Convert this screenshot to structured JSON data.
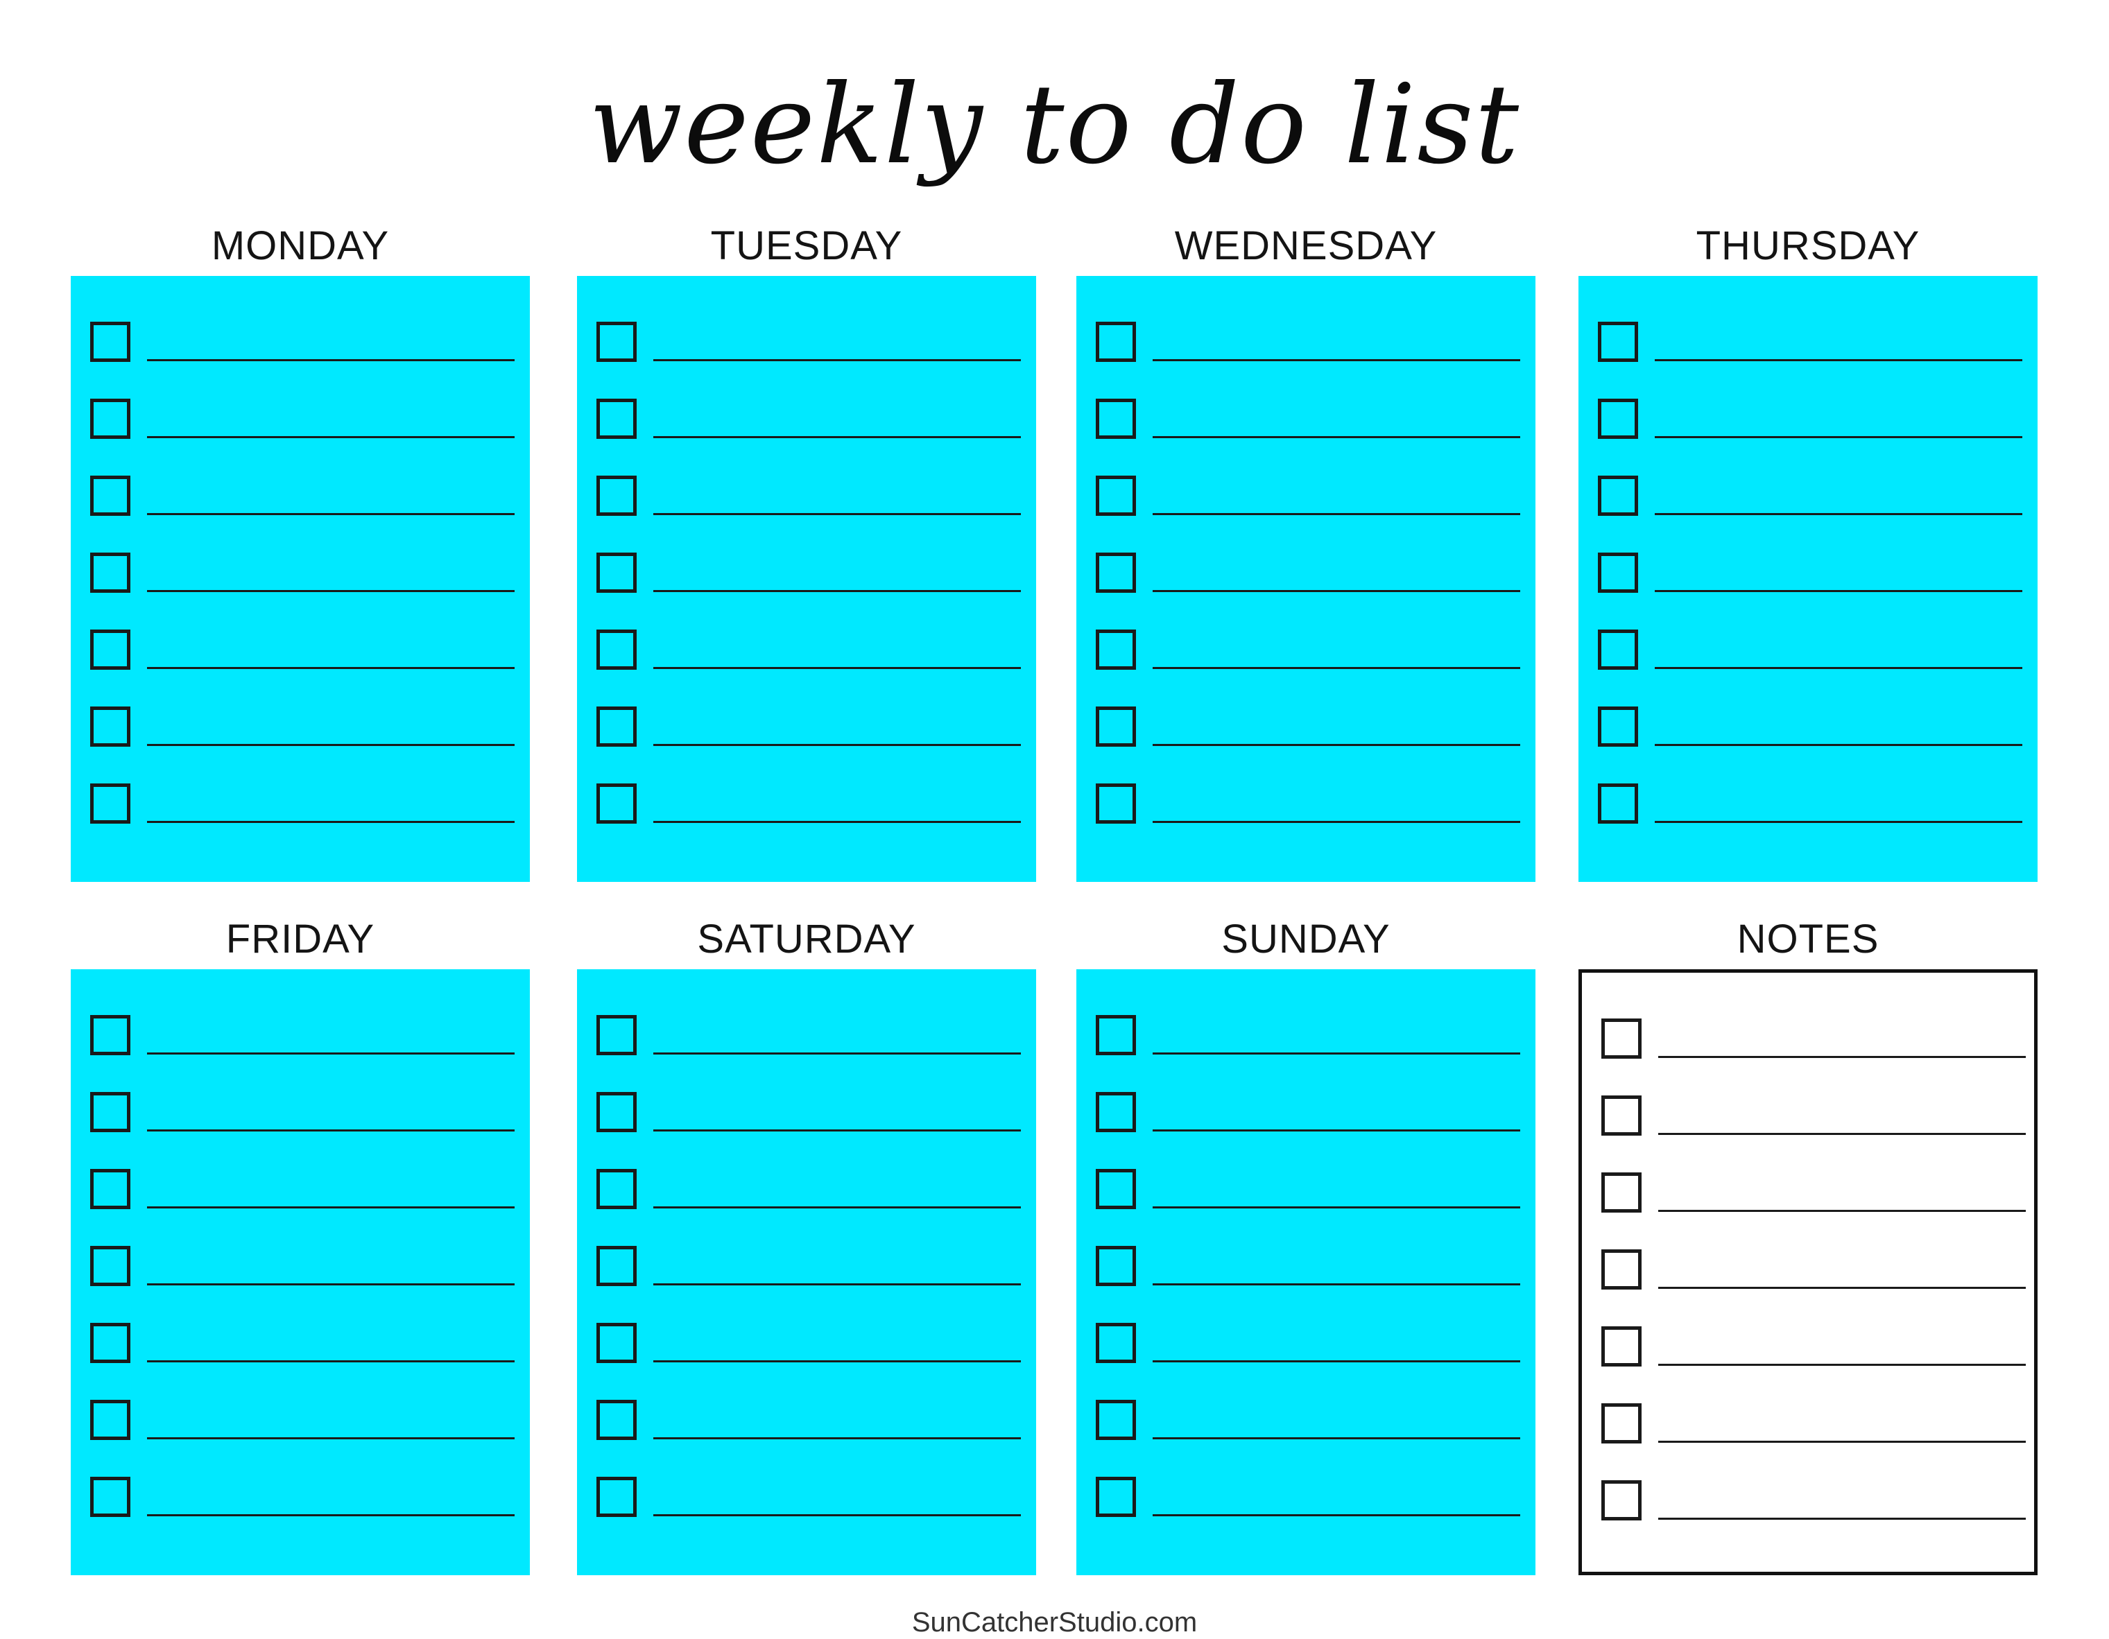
{
  "title": "weekly to do list",
  "colors": {
    "day_box": "#00e9ff",
    "notes_box": "#ffffff",
    "ink": "#111111"
  },
  "sections": [
    {
      "heading": "MONDAY",
      "type": "day",
      "items": 7
    },
    {
      "heading": "TUESDAY",
      "type": "day",
      "items": 7
    },
    {
      "heading": "WEDNESDAY",
      "type": "day",
      "items": 7
    },
    {
      "heading": "THURSDAY",
      "type": "day",
      "items": 7
    },
    {
      "heading": "FRIDAY",
      "type": "day",
      "items": 7
    },
    {
      "heading": "SATURDAY",
      "type": "day",
      "items": 7
    },
    {
      "heading": "SUNDAY",
      "type": "day",
      "items": 7
    },
    {
      "heading": "NOTES",
      "type": "notes",
      "items": 7
    }
  ],
  "footer": "SunCatcherStudio.com"
}
